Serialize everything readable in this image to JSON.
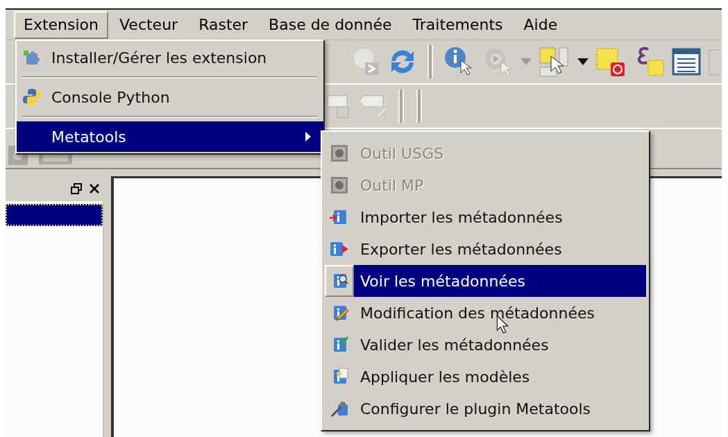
{
  "menubar": [
    {
      "label": "Extension",
      "selected": true
    },
    {
      "label": "Vecteur",
      "selected": false
    },
    {
      "label": "Raster",
      "selected": false
    },
    {
      "label": "Base de donnée",
      "selected": false
    },
    {
      "label": "Traitements",
      "selected": false
    },
    {
      "label": "Aide",
      "selected": false
    }
  ],
  "extension_menu": {
    "items": [
      {
        "kind": "item",
        "label": "Installer/Gérer les extension",
        "selected": false
      },
      {
        "kind": "separator"
      },
      {
        "kind": "item",
        "label": "Console Python",
        "selected": false
      },
      {
        "kind": "separator"
      },
      {
        "kind": "submenu",
        "label": "Metatools",
        "selected": true
      }
    ]
  },
  "metatools_submenu": {
    "items": [
      {
        "label": "Outil USGS",
        "disabled": true,
        "selected": false
      },
      {
        "label": "Outil MP",
        "disabled": true,
        "selected": false
      },
      {
        "label": "Importer les métadonnées",
        "disabled": false,
        "selected": false
      },
      {
        "label": "Exporter les métadonnées",
        "disabled": false,
        "selected": false
      },
      {
        "label": "Voir les métadonnées",
        "disabled": false,
        "selected": true
      },
      {
        "label": "Modification des métadonnées",
        "disabled": false,
        "selected": false
      },
      {
        "label": "Valider les métadonnées",
        "disabled": false,
        "selected": false
      },
      {
        "label": "Appliquer les modèles",
        "disabled": false,
        "selected": false
      },
      {
        "label": "Configurer le plugin Metatools",
        "disabled": false,
        "selected": false
      }
    ]
  },
  "layers_panel": {
    "rows": [
      {
        "selected": true
      }
    ]
  }
}
